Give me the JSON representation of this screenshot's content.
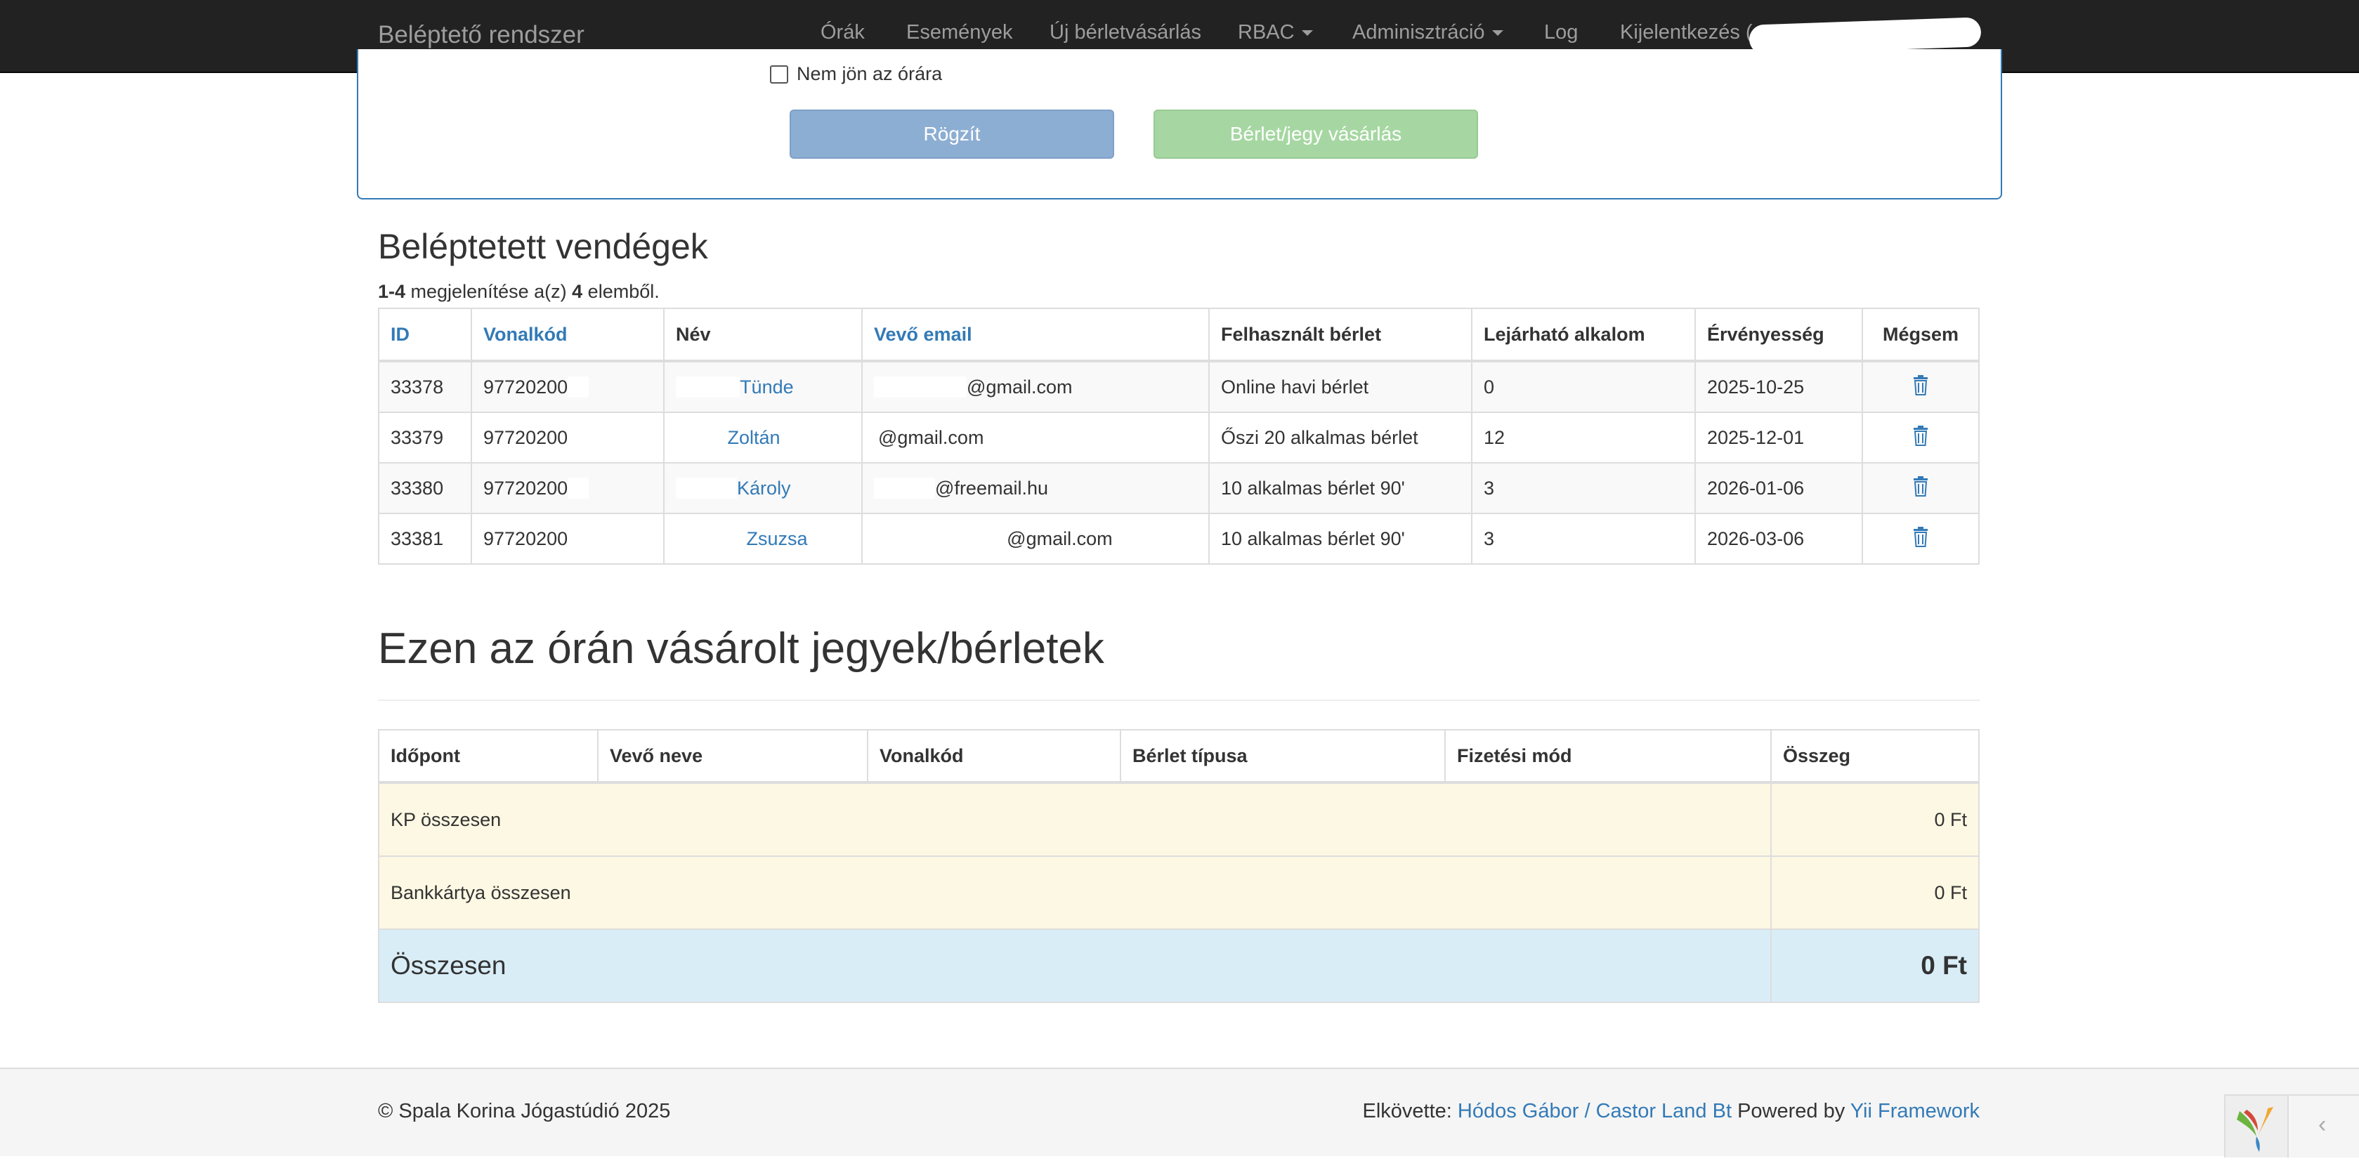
{
  "navbar": {
    "brand": "Beléptető rendszer",
    "items": [
      {
        "label": "Órák"
      },
      {
        "label": "Események"
      },
      {
        "label": "Új bérletvásárlás"
      },
      {
        "label": "RBAC"
      },
      {
        "label": "Adminisztráció"
      },
      {
        "label": "Log"
      },
      {
        "label": "Kijelentkezés ("
      }
    ]
  },
  "form": {
    "checkbox_label": "Nem jön az órára",
    "submit_label": "Rögzít",
    "buy_label": "Bérlet/jegy vásárlás"
  },
  "guests": {
    "title": "Beléptetett vendégek",
    "summary_range": "1-4",
    "summary_mid": " megjelenítése a(z) ",
    "summary_total": "4",
    "summary_end": " elemből.",
    "headers": [
      "ID",
      "Vonalkód",
      "Név",
      "Vevő email",
      "Felhasznált bérlet",
      "Lejárható alkalom",
      "Érvényesség",
      "Mégsem"
    ],
    "rows": [
      {
        "id": "33378",
        "barcode": "97720200",
        "name": "Tünde",
        "email": "@gmail.com",
        "pass": "Online havi bérlet",
        "remaining": "0",
        "valid": "2025-10-25"
      },
      {
        "id": "33379",
        "barcode": "97720200",
        "name": "Zoltán",
        "email": "@gmail.com",
        "pass": "Őszi 20 alkalmas bérlet",
        "remaining": "12",
        "valid": "2025-12-01"
      },
      {
        "id": "33380",
        "barcode": "97720200",
        "name": "Károly",
        "email": "@freemail.hu",
        "pass": "10 alkalmas bérlet 90'",
        "remaining": "3",
        "valid": "2026-01-06"
      },
      {
        "id": "33381",
        "barcode": "97720200",
        "name": "Zsuzsa",
        "email": "@gmail.com",
        "pass": "10 alkalmas bérlet 90'",
        "remaining": "3",
        "valid": "2026-03-06"
      }
    ]
  },
  "purchases": {
    "title": "Ezen az órán vásárolt jegyek/bérletek",
    "headers": [
      "Időpont",
      "Vevő neve",
      "Vonalkód",
      "Bérlet típusa",
      "Fizetési mód",
      "Összeg"
    ],
    "cash_label": "KP összesen",
    "cash_value": "0 Ft",
    "card_label": "Bankkártya összesen",
    "card_value": "0 Ft",
    "total_label": "Összesen",
    "total_value": "0 Ft"
  },
  "footer": {
    "copyright": "© Spala Korina Jógastúdió 2025",
    "made_by_prefix": "Elkövette: ",
    "made_by_link": "Hódos Gábor / Castor Land Bt",
    "powered_prefix": " Powered by ",
    "powered_link": "Yii Framework"
  },
  "colors": {
    "navbar": "#222222",
    "link": "#337ab7",
    "warning_row": "#fcf8e3",
    "info_row": "#d9edf7"
  }
}
